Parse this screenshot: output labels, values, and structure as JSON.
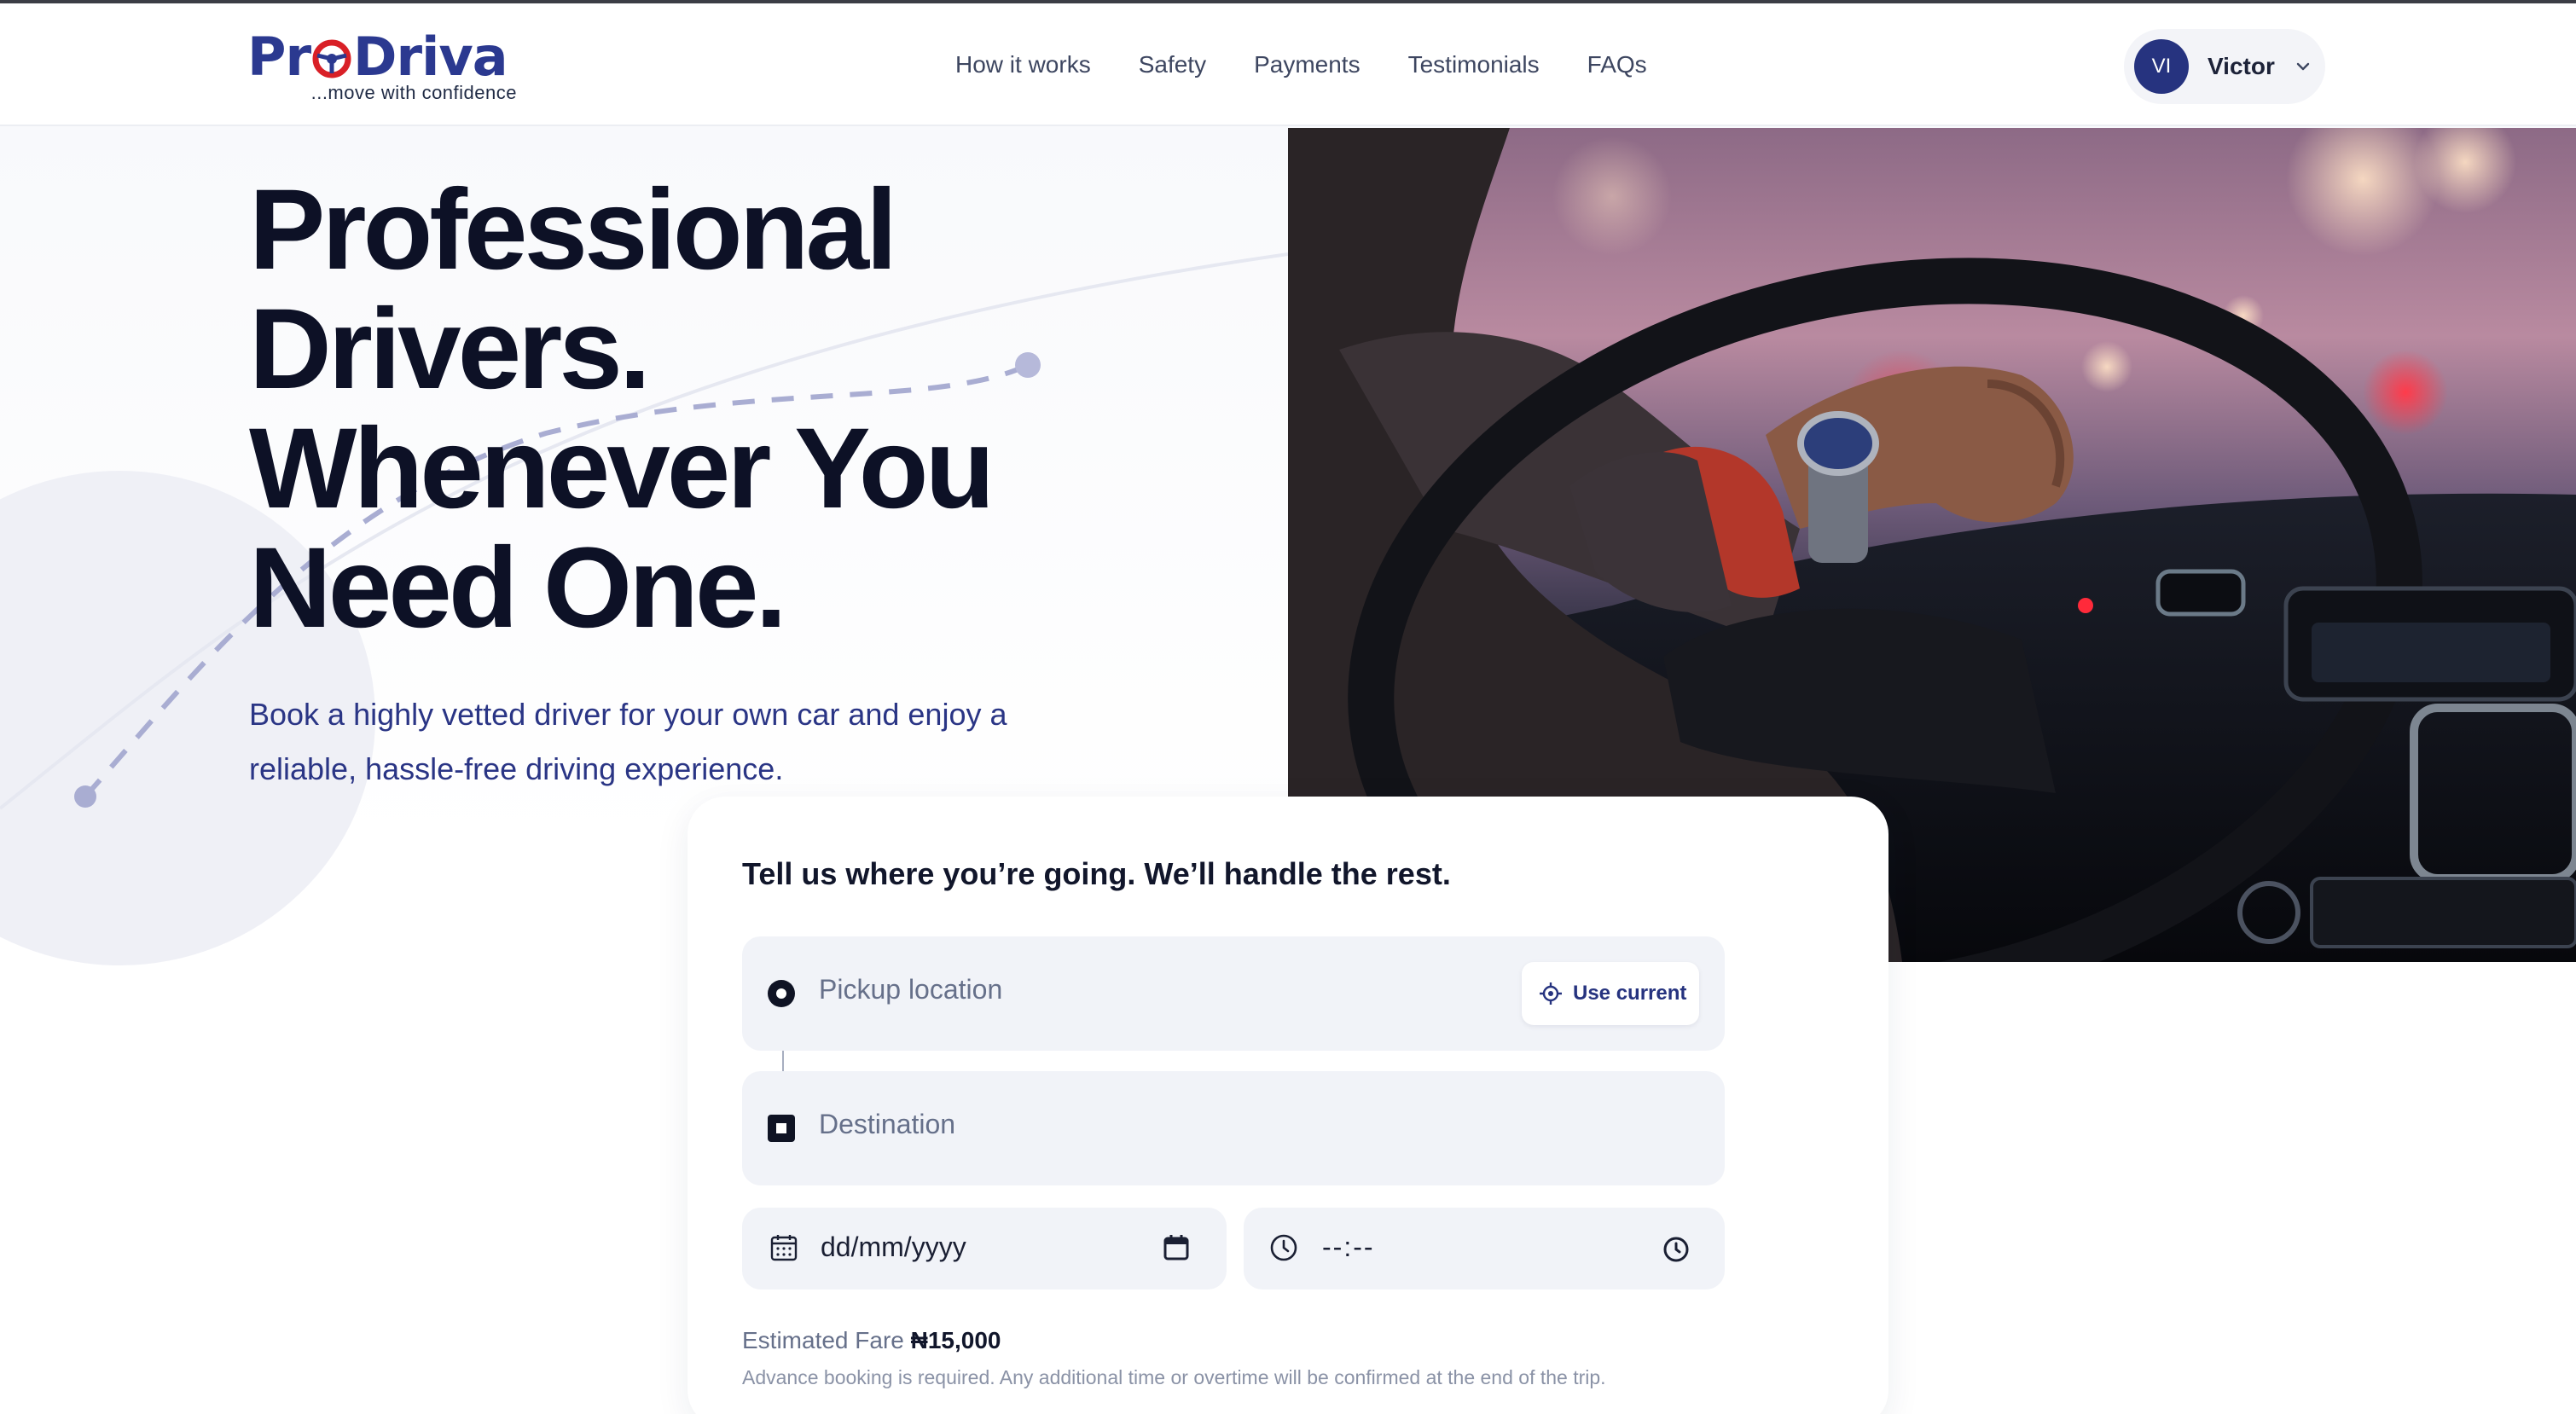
{
  "brand": {
    "logo_text_left": "Pr",
    "logo_text_right": "Driva",
    "tagline": "...move with confidence",
    "primary_color": "#2b3990",
    "accent_color": "#d92027"
  },
  "nav": {
    "items": [
      {
        "label": "How it works"
      },
      {
        "label": "Safety"
      },
      {
        "label": "Payments"
      },
      {
        "label": "Testimonials"
      },
      {
        "label": "FAQs"
      }
    ]
  },
  "user": {
    "initials": "VI",
    "name": "Victor",
    "menu_icon": "chevron-down-icon"
  },
  "hero": {
    "title_lines": [
      "Professional",
      "Drivers.",
      "Whenever You",
      "Need One."
    ],
    "subtitle": "Book a highly vetted driver for your own car and enjoy a reliable, hassle-free driving experience."
  },
  "booking": {
    "heading": "Tell us where you’re going. We’ll handle the rest.",
    "pickup_placeholder": "Pickup location",
    "use_current_label": "Use current",
    "destination_placeholder": "Destination",
    "date_placeholder": "dd/mm/yyyy",
    "time_placeholder": "--:--",
    "fare_label": "Estimated Fare",
    "fare_value": "₦15,000",
    "note": "Advance booking is required. Any additional time or overtime will be confirmed at the end of the trip."
  },
  "icons": {
    "pickup": "radio-dot-icon",
    "destination": "square-stop-icon",
    "date": "calendar-icon",
    "time": "clock-icon",
    "use_current": "crosshair-icon"
  }
}
